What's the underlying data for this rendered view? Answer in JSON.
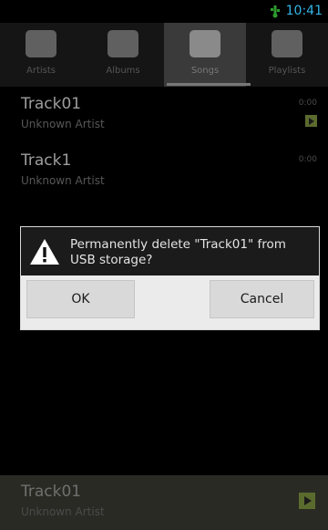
{
  "status_bar": {
    "time": "10:41",
    "icon": "usb-icon"
  },
  "tabs": [
    {
      "label": "Artists",
      "icon": "artists-icon"
    },
    {
      "label": "Albums",
      "icon": "albums-icon"
    },
    {
      "label": "Songs",
      "icon": "songs-icon",
      "active": true
    },
    {
      "label": "Playlists",
      "icon": "playlists-icon"
    }
  ],
  "tracks": [
    {
      "title": "Track01",
      "artist": "Unknown Artist",
      "duration": "0:00"
    },
    {
      "title": "Track1",
      "artist": "Unknown Artist",
      "duration": "0:00"
    }
  ],
  "dialog": {
    "icon": "warning-icon",
    "message": "Permanently delete \"Track01\" from USB storage?",
    "ok_label": "OK",
    "cancel_label": "Cancel"
  },
  "now_playing": {
    "title": "Track01",
    "artist": "Unknown Artist",
    "icon": "play-icon"
  }
}
